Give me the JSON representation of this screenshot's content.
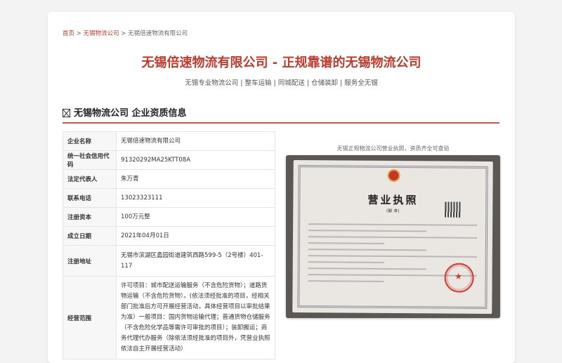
{
  "breadcrumb": {
    "home": "首页",
    "sep1": " > ",
    "category": "无锡物流公司",
    "sep2": " > ",
    "current": "无锡倍速物流有限公司"
  },
  "page_title": "无锡倍速物流有限公司 - 正规靠谱的无锡物流公司",
  "subnav": "无锡专业物流公司 | 整车运输 | 同城配送 | 仓储装卸 | 服务全无锡",
  "section": {
    "title": "无锡物流公司 企业资质信息"
  },
  "company_info": {
    "rows": [
      {
        "key": "企业名称",
        "value": "无锡倍速物流有限公司"
      },
      {
        "key": "统一社会信用代码",
        "value": "91320292MA25KTT08A"
      },
      {
        "key": "法定代表人",
        "value": "朱万青"
      },
      {
        "key": "联系电话",
        "value": "13023323111"
      },
      {
        "key": "注册资本",
        "value": "100万元整"
      },
      {
        "key": "成立日期",
        "value": "2021年04月01日"
      },
      {
        "key": "注册地址",
        "value": "无锡市滨湖区蠡园街道建筑西路599-5（2号楼）401-117"
      },
      {
        "key": "经营范围",
        "value": "许可项目：城市配送运输服务（不含危险货物）；道路货物运输（不含危险货物）。(依法须经批准的项目，经相关部门批准后方可开展经营活动，具体经营项目以审批结果为准）一般项目：国内货物运输代理；普通货物仓储服务（不含危险化学品等需许可审批的项目）；装卸搬运；商务代理代办服务（除依法须经批准的项目外，凭营业执照依法自主开展经营活动）"
      }
    ]
  },
  "license_photo": {
    "caption": "无锡正规物流公司营业执照，资质齐全可查验",
    "license_title": "营业执照",
    "license_subtitle": "(副 本)"
  },
  "colors": {
    "accent": "#c0392b",
    "page_bg": "#f3f3f3",
    "card_bg": "#ffffff"
  }
}
